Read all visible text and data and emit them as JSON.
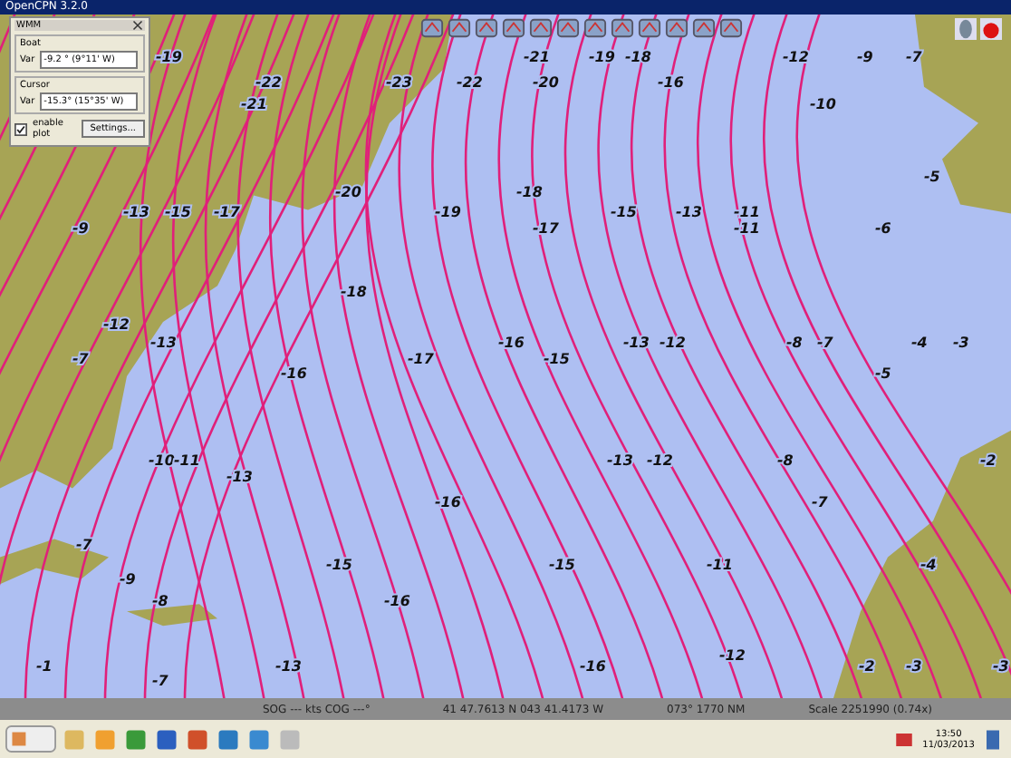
{
  "window": {
    "title": "OpenCPN 3.2.0"
  },
  "wmm_dialog": {
    "title": "WMM",
    "sections": [
      {
        "label": "Boat",
        "field_label": "Var",
        "value": "-9.2 ° (9°11' W)"
      },
      {
        "label": "Cursor",
        "field_label": "Var",
        "value": "-15.3° (15°35' W)"
      }
    ],
    "enable_plot": {
      "label": "enable plot",
      "checked": true
    },
    "settings_button": "Settings..."
  },
  "map_labels": [
    "-19",
    "-21",
    "-19",
    "-18",
    "-12",
    "-9",
    "-7",
    "-22",
    "-23",
    "-22",
    "-20",
    "-16",
    "-21",
    "-10",
    "-5",
    "-20",
    "-18",
    "-13",
    "-15",
    "-17",
    "-19",
    "-15",
    "-13",
    "-11",
    "-9",
    "-17",
    "-11",
    "-6",
    "-18",
    "-12",
    "-13",
    "-16",
    "-13",
    "-12",
    "-8",
    "-7",
    "-4",
    "-3",
    "-7",
    "-17",
    "-15",
    "-16",
    "-5",
    "-10",
    "-11",
    "-13",
    "-12",
    "-8",
    "-2",
    "-13",
    "-16",
    "-7",
    "-7",
    "-15",
    "-15",
    "-11",
    "-4",
    "-9",
    "-8",
    "-16",
    "-12",
    "-1",
    "-13",
    "-16",
    "-2",
    "-3",
    "-3",
    "-7"
  ],
  "status_bar": {
    "speed_course": "SOG --- kts  COG ---°",
    "position": "41 47.7613 N  043 41.4173 W",
    "range": "073°  1770 NM",
    "scale": "Scale 2251990 (0.74x)"
  },
  "taskbar": {
    "clock_time": "13:50",
    "clock_date": "11/03/2013"
  }
}
